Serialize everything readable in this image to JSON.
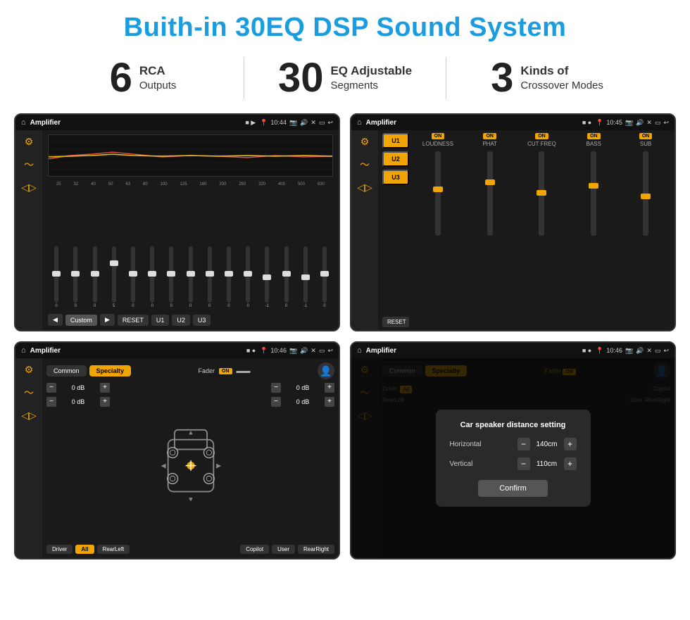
{
  "page": {
    "title": "Buith-in 30EQ DSP Sound System"
  },
  "stats": [
    {
      "id": "rca",
      "number": "6",
      "label_main": "RCA",
      "label_sub": "Outputs"
    },
    {
      "id": "eq",
      "number": "30",
      "label_main": "EQ Adjustable",
      "label_sub": "Segments"
    },
    {
      "id": "crossover",
      "number": "3",
      "label_main": "Kinds of",
      "label_sub": "Crossover Modes"
    }
  ],
  "screens": [
    {
      "id": "screen1",
      "title": "Amplifier",
      "time": "10:44",
      "type": "eq"
    },
    {
      "id": "screen2",
      "title": "Amplifier",
      "time": "10:45",
      "type": "amp"
    },
    {
      "id": "screen3",
      "title": "Amplifier",
      "time": "10:46",
      "type": "balance"
    },
    {
      "id": "screen4",
      "title": "Amplifier",
      "time": "10:46",
      "type": "dialog"
    }
  ],
  "eq": {
    "frequencies": [
      "25",
      "32",
      "40",
      "50",
      "63",
      "80",
      "100",
      "125",
      "160",
      "200",
      "250",
      "320",
      "400",
      "500",
      "630"
    ],
    "values": [
      "0",
      "0",
      "0",
      "5",
      "0",
      "0",
      "0",
      "0",
      "0",
      "0",
      "0",
      "-1",
      "0",
      "-1",
      "0"
    ],
    "presets": [
      "Custom",
      "RESET",
      "U1",
      "U2",
      "U3"
    ]
  },
  "amp": {
    "presets": [
      "U1",
      "U2",
      "U3"
    ],
    "channels": [
      {
        "label": "LOUDNESS",
        "on": true
      },
      {
        "label": "PHAT",
        "on": true
      },
      {
        "label": "CUT FREQ",
        "on": true
      },
      {
        "label": "BASS",
        "on": true
      },
      {
        "label": "SUB",
        "on": true
      }
    ],
    "reset_label": "RESET"
  },
  "balance": {
    "tabs": [
      "Common",
      "Specialty"
    ],
    "active_tab": "Specialty",
    "fader_label": "Fader",
    "fader_on": true,
    "db_values": [
      "0 dB",
      "0 dB",
      "0 dB",
      "0 dB"
    ],
    "bottom_buttons": [
      "Driver",
      "All",
      "User",
      "RearLeft",
      "Copilot",
      "RearRight"
    ]
  },
  "dialog": {
    "bg_tabs": [
      "Common",
      "Specialty"
    ],
    "title": "Car speaker distance setting",
    "horizontal_label": "Horizontal",
    "horizontal_value": "140cm",
    "vertical_label": "Vertical",
    "vertical_value": "110cm",
    "confirm_label": "Confirm",
    "bottom_buttons": [
      "Driver",
      "All",
      "User",
      "RearLeft",
      "Copilot",
      "RearRight"
    ]
  }
}
